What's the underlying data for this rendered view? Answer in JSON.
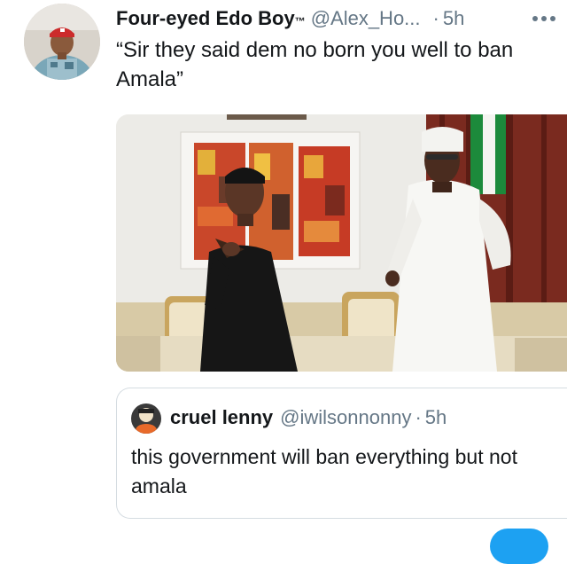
{
  "tweet": {
    "author_name": "Four-eyed Edo Boy",
    "author_badge": "™",
    "handle": "@Alex_Ho...",
    "separator": "·",
    "time": "5h",
    "text": "“Sir they said dem no born you well to ban Amala”",
    "more_icon": "more-horizontal-icon",
    "photo_alt": "photo"
  },
  "quoted_tweet": {
    "author_name": "cruel lenny",
    "handle": "@iwilsonnonny",
    "separator": "·",
    "time": "5h",
    "text": "this government will ban everything but not amala"
  },
  "colors": {
    "text_primary": "#14171a",
    "text_secondary": "#657786",
    "border": "#d5dce1",
    "accent": "#1da1f2"
  }
}
